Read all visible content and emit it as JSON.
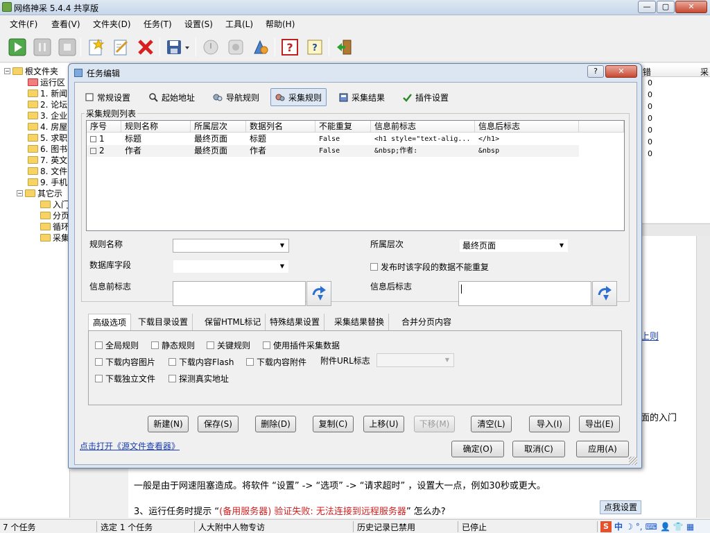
{
  "app": {
    "title": "网络神采 5.4.4 共享版",
    "window_controls": {
      "minimize": "—",
      "maximize": "▢",
      "close": "✕"
    }
  },
  "menu": [
    "文件(F)",
    "查看(V)",
    "文件夹(D)",
    "任务(T)",
    "设置(S)",
    "工具(L)",
    "帮助(H)"
  ],
  "toolbar": {
    "icons": [
      "play-icon",
      "pause-icon",
      "stop-icon",
      "new-task-icon",
      "edit-task-icon",
      "delete-task-icon",
      "save-icon",
      "disabled-icon-1",
      "disabled-icon-2",
      "settings-wizard-icon",
      "help-icon",
      "about-icon",
      "exit-icon"
    ]
  },
  "tree": {
    "root": "根文件夹",
    "items": [
      "运行区",
      "1. 新闻",
      "2. 论坛",
      "3. 企业",
      "4. 房屋",
      "5. 求职",
      "6. 图书",
      "7. 英文",
      "8. 文件",
      "9. 手机"
    ],
    "other": "其它示",
    "other_children": [
      "入门",
      "分页",
      "循环",
      "采集"
    ]
  },
  "background": {
    "right_header": [
      "错",
      "采"
    ],
    "right_values": [
      "0",
      "0",
      "0",
      "0",
      "0",
      "0",
      "0"
    ],
    "link_fragment": "上则",
    "fragment_intro": "面的入门",
    "line1": "一般是由于网速阻塞造成。将软件 “设置” -> “选项” -> “请求超时” ，设置大一点，例如30秒或更大。",
    "line2_prefix": "3、运行任务时提示 “",
    "line2_red": "(备用服务器) 验证失败: 无法连接到远程服务器",
    "line2_suffix": "” 怎么办?",
    "click_settings": "点我设置"
  },
  "status": {
    "task_count": "7 个任务",
    "selected": "选定 1 个任务",
    "folder": "人大附中人物专访",
    "history": "历史记录已禁用",
    "state": "已停止"
  },
  "tray": {
    "ime": "中",
    "icons": [
      "moon-icon",
      "punct-icon",
      "keyboard-icon",
      "user-icon",
      "shirt-icon",
      "grid-icon"
    ]
  },
  "dialog": {
    "title": "任务编辑",
    "controls": {
      "help": "?",
      "close": "✕"
    },
    "tabs": [
      "常规设置",
      "起始地址",
      "导航规则",
      "采集规则",
      "采集结果",
      "插件设置"
    ],
    "active_tab": "采集规则",
    "rules_group": "采集规则列表",
    "columns": [
      "序号",
      "规则名称",
      "所属层次",
      "数据列名",
      "不能重复",
      "信息前标志",
      "信息后标志"
    ],
    "rows": [
      {
        "no": "1",
        "name": "标题",
        "level": "最终页面",
        "column": "标题",
        "unique": "False",
        "prefix": "<h1 style=\"text-alig...",
        "suffix": "</h1>"
      },
      {
        "no": "2",
        "name": "作者",
        "level": "最终页面",
        "column": "作者",
        "unique": "False",
        "prefix": "&nbsp;作者:",
        "suffix": "&nbsp"
      }
    ],
    "form": {
      "rule_name_label": "规则名称",
      "rule_name_value": "",
      "level_label": "所属层次",
      "level_value": "最终页面",
      "db_field_label": "数据库字段",
      "db_field_value": "",
      "no_dup_label": "发布时该字段的数据不能重复",
      "prefix_label": "信息前标志",
      "suffix_label": "信息后标志"
    },
    "subtabs": [
      "高级选项",
      "下载目录设置",
      "保留HTML标记",
      "特殊结果设置",
      "采集结果替换",
      "合并分页内容"
    ],
    "active_subtab": "高级选项",
    "options": {
      "global_rule": "全局规则",
      "static_rule": "静态规则",
      "key_rule": "关键规则",
      "use_plugin": "使用插件采集数据",
      "dl_images": "下载内容图片",
      "dl_flash": "下载内容Flash",
      "dl_attach": "下载内容附件",
      "attach_url_label": "附件URL标志",
      "dl_standalone": "下载独立文件",
      "detect_real": "探测真实地址"
    },
    "buttons": [
      "新建(N)",
      "保存(S)",
      "删除(D)",
      "复制(C)",
      "上移(U)",
      "下移(M)",
      "清空(L)",
      "导入(I)",
      "导出(E)"
    ],
    "source_link": "点击打开《源文件查看器》",
    "footer_buttons": [
      "确定(O)",
      "取消(C)",
      "应用(A)"
    ]
  }
}
